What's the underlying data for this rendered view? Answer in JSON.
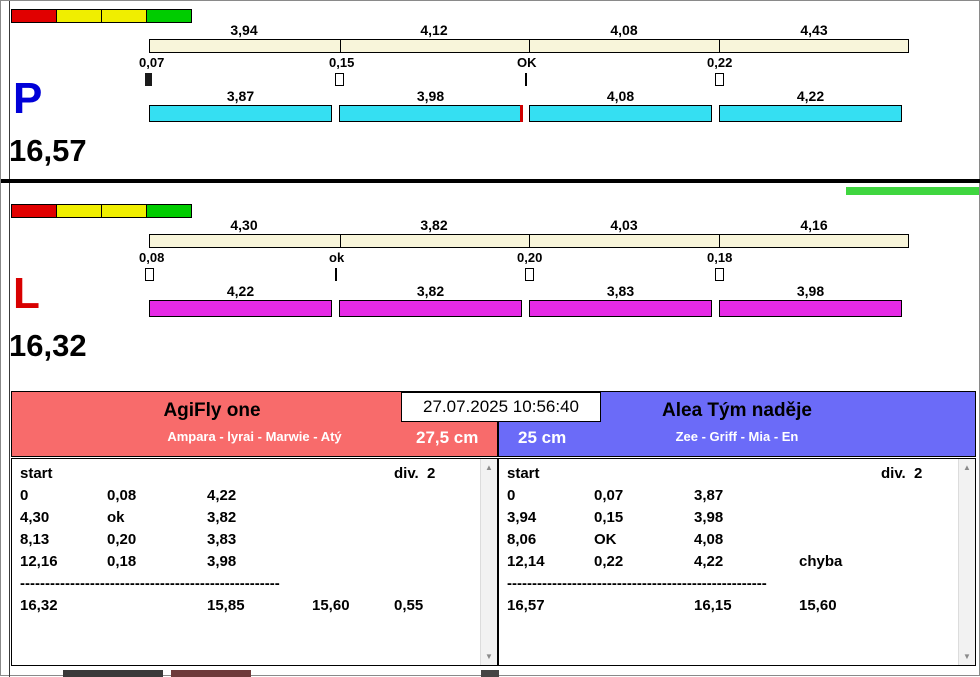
{
  "header": {
    "datetime": "27.07.2025 10:56:40"
  },
  "icons": {
    "scroll_up": "▲",
    "scroll_down": "▼"
  },
  "strip_colors": [
    "#e10000",
    "#f0ee00",
    "#f0ee00",
    "#00cc00"
  ],
  "lanes": [
    {
      "letter": "P",
      "letter_color": "#0000d8",
      "bar_color": "#35dff2",
      "total": "16,57",
      "splits": [
        "3,94",
        "4,12",
        "4,08",
        "4,43"
      ],
      "changes": [
        {
          "label": "0,07",
          "marker": "bar"
        },
        {
          "label": "0,15",
          "marker": "box"
        },
        {
          "label": "OK",
          "marker": "line"
        },
        {
          "label": "0,22",
          "marker": "box"
        }
      ],
      "dogs": [
        "3,87",
        "3,98",
        "4,08",
        "4,22"
      ]
    },
    {
      "letter": "L",
      "letter_color": "#d80000",
      "bar_color": "#e62ae6",
      "total": "16,32",
      "splits": [
        "4,30",
        "3,82",
        "4,03",
        "4,16"
      ],
      "changes": [
        {
          "label": "0,08",
          "marker": "box"
        },
        {
          "label": "ok",
          "marker": "line"
        },
        {
          "label": "0,20",
          "marker": "box"
        },
        {
          "label": "0,18",
          "marker": "box"
        }
      ],
      "dogs": [
        "4,22",
        "3,82",
        "3,83",
        "3,98"
      ]
    }
  ],
  "teams": [
    {
      "name": "AgiFly one",
      "members": "Ampara - lyrai - Marwie - Atý",
      "height": "27,5 cm",
      "header_color": "#f86b6b",
      "table": {
        "col_start": "start",
        "col_div": "div.  2",
        "rows": [
          [
            "0",
            "0,08",
            "4,22",
            ""
          ],
          [
            "4,30",
            "ok",
            "3,82",
            ""
          ],
          [
            "8,13",
            "0,20",
            "3,83",
            ""
          ],
          [
            "12,16",
            "0,18",
            "3,98",
            ""
          ]
        ],
        "separator": "----------------------------------------------------",
        "totals": [
          "16,32",
          "",
          "15,85",
          "15,60",
          "0,55"
        ]
      }
    },
    {
      "name": "Alea Tým naděje",
      "members": "Zee - Griff - Mia - En",
      "height": "25 cm",
      "header_color": "#6b6bf8",
      "table": {
        "col_start": "start",
        "col_div": "div.  2",
        "rows": [
          [
            "0",
            "0,07",
            "3,87",
            ""
          ],
          [
            "3,94",
            "0,15",
            "3,98",
            ""
          ],
          [
            "8,06",
            "OK",
            "4,08",
            ""
          ],
          [
            "12,14",
            "0,22",
            "4,22",
            "chyba"
          ]
        ],
        "separator": "----------------------------------------------------",
        "totals": [
          "16,57",
          "",
          "16,15",
          "15,60",
          ""
        ]
      }
    }
  ]
}
